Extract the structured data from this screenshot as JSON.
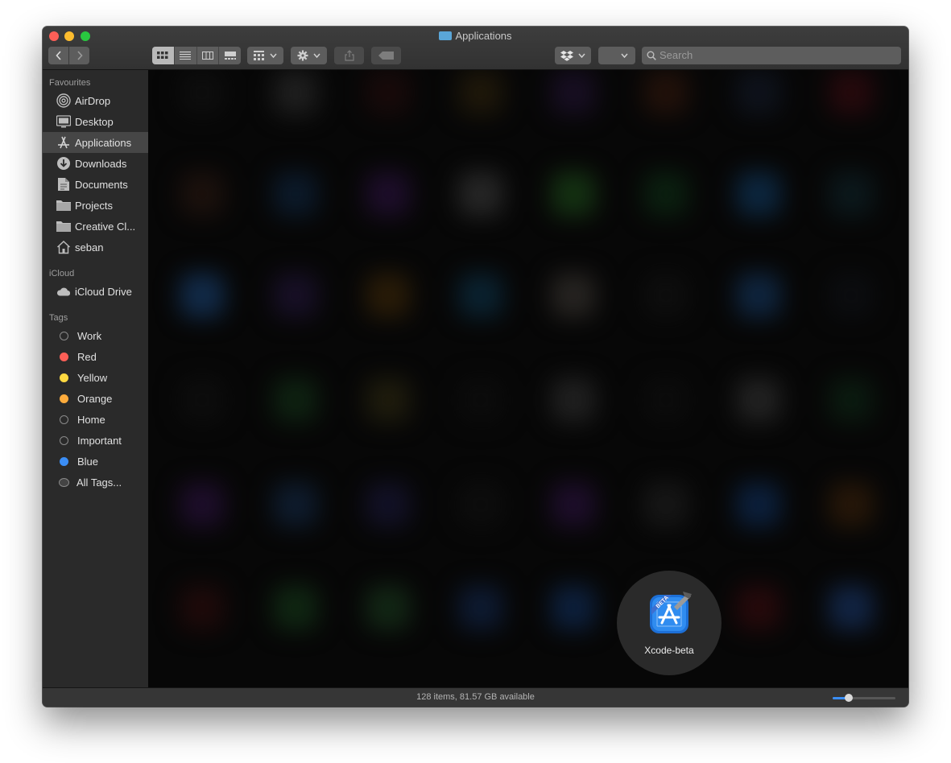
{
  "window": {
    "title": "Applications",
    "title_icon": "folder-icon"
  },
  "toolbar": {
    "back_icon": "chevron-left-icon",
    "forward_icon": "chevron-right-icon",
    "view_modes": [
      "icon-view-icon",
      "list-view-icon",
      "column-view-icon",
      "gallery-view-icon"
    ],
    "group_icon": "group-by-icon",
    "action_icon": "gear-icon",
    "share_icon": "share-icon",
    "tag_icon": "tag-icon",
    "dropbox_icon": "dropbox-icon",
    "search": {
      "placeholder": "Search"
    }
  },
  "sidebar": {
    "favourites_heading": "Favourites",
    "favourites": [
      {
        "label": "AirDrop",
        "icon": "airdrop-icon"
      },
      {
        "label": "Desktop",
        "icon": "desktop-icon"
      },
      {
        "label": "Applications",
        "icon": "applications-icon",
        "selected": true
      },
      {
        "label": "Downloads",
        "icon": "downloads-icon"
      },
      {
        "label": "Documents",
        "icon": "documents-icon"
      },
      {
        "label": "Projects",
        "icon": "folder-icon"
      },
      {
        "label": "Creative Cl...",
        "icon": "folder-icon"
      },
      {
        "label": "seban",
        "icon": "home-icon"
      }
    ],
    "icloud_heading": "iCloud",
    "icloud": [
      {
        "label": "iCloud Drive",
        "icon": "cloud-icon"
      }
    ],
    "tags_heading": "Tags",
    "tags": [
      {
        "label": "Work",
        "color": "#2a2a2a"
      },
      {
        "label": "Red",
        "color": "#fc5f57"
      },
      {
        "label": "Yellow",
        "color": "#fed941"
      },
      {
        "label": "Orange",
        "color": "#fdab3c"
      },
      {
        "label": "Home",
        "color": "#2a2a2a"
      },
      {
        "label": "Important",
        "color": "#2a2a2a"
      },
      {
        "label": "Blue",
        "color": "#3b8ef6"
      },
      {
        "label": "All Tags...",
        "color": "#555555"
      }
    ]
  },
  "content": {
    "highlighted_app": {
      "label": "Xcode-beta",
      "icon": "xcode-beta-icon"
    }
  },
  "status": {
    "text": "128 items, 81.57 GB available",
    "zoom_fraction": 0.25
  },
  "colors": {
    "accent": "#3b8ef6",
    "selection": "#464646"
  }
}
